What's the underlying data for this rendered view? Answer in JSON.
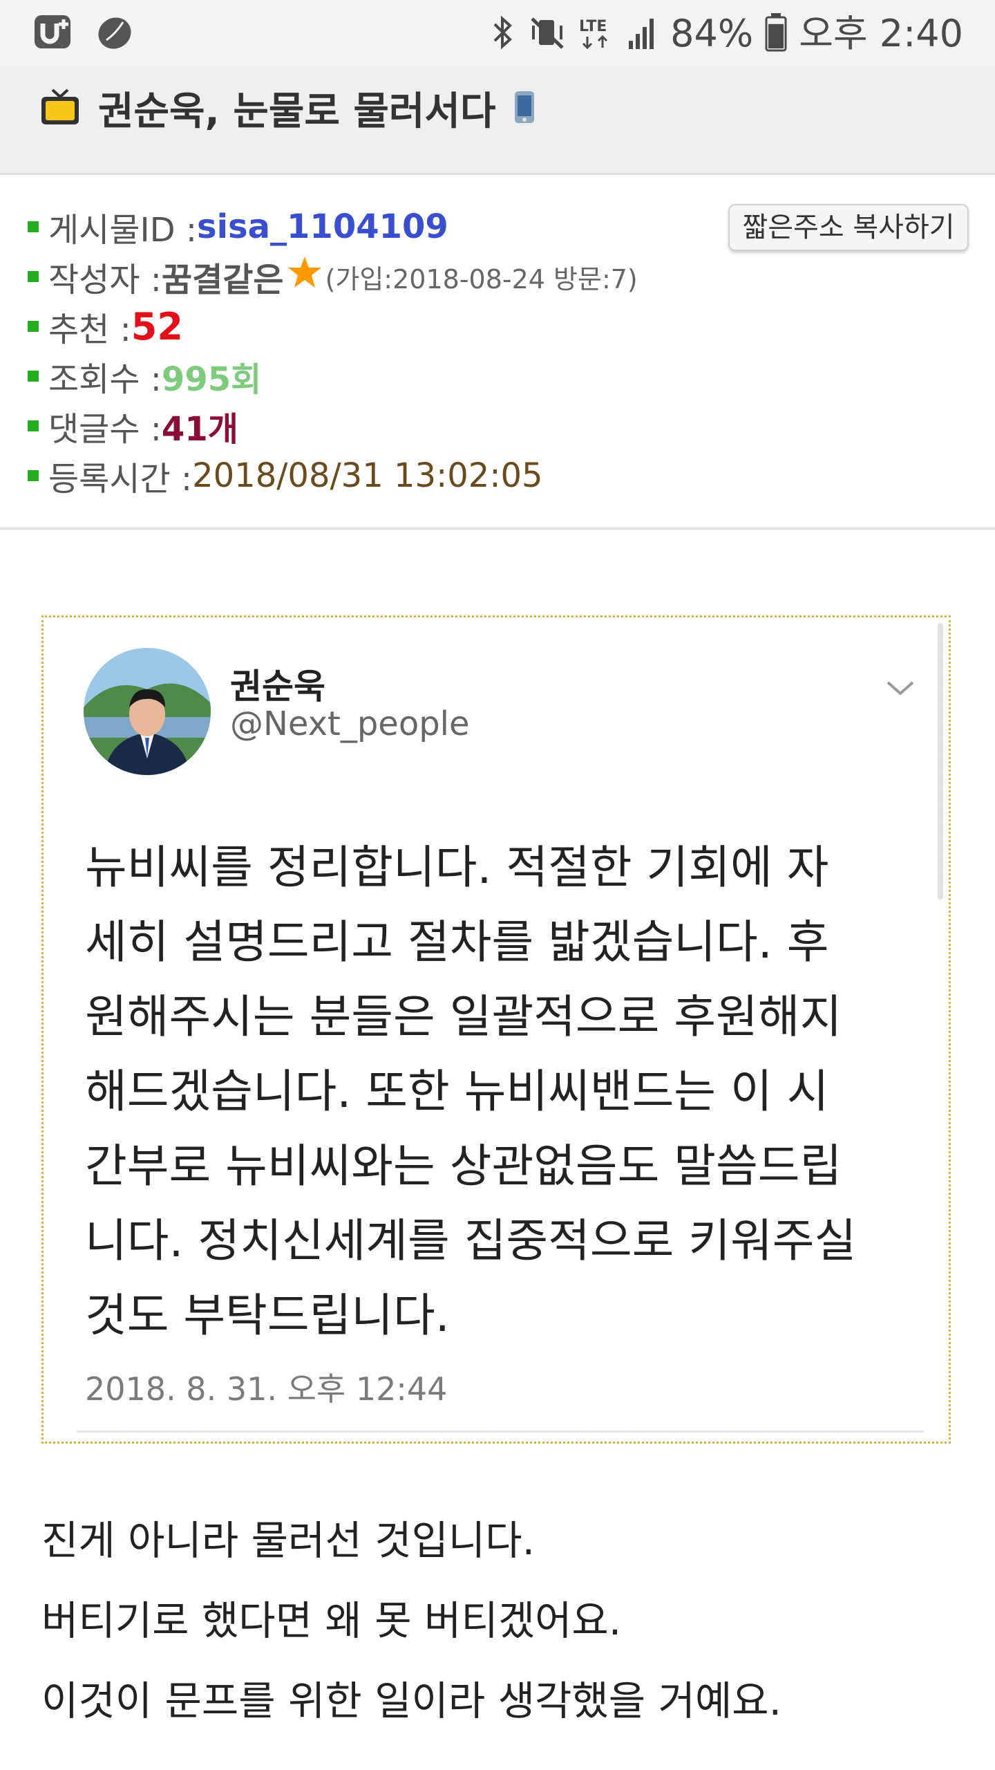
{
  "status_bar": {
    "left_icons": [
      "u-plus-icon",
      "shield-leaf-icon"
    ],
    "right_icons": [
      "bluetooth-icon",
      "vibrate-mute-icon",
      "lte-icon",
      "signal-icon"
    ],
    "battery_percent": "84%",
    "battery_level": 0.84,
    "time": "오후 2:40"
  },
  "post": {
    "title": "권순욱, 눈물로 물러서다",
    "title_icon": "tv-icon",
    "device_icon": "mobile-icon"
  },
  "meta": {
    "copy_button_label": "짧은주소 복사하기",
    "rows": {
      "post_id": {
        "label": "게시물ID : ",
        "value": "sisa_1104109",
        "color": "#3a4fd0"
      },
      "author": {
        "label": "작성자 : ",
        "value": "꿈결같은",
        "extra": "(가입:2018-08-24 방문:7)",
        "badge_icon": "star-icon",
        "color": "#555555",
        "badge_color": "#ff9900"
      },
      "recommend": {
        "label": "추천 : ",
        "value": "52",
        "color": "#e3101a"
      },
      "views": {
        "label": "조회수 : ",
        "value": "995회",
        "color": "#7ecb7e"
      },
      "comments": {
        "label": "댓글수 : ",
        "value": "41개",
        "color": "#8b0d3a"
      },
      "registered": {
        "label": "등록시간 : ",
        "value": "2018/08/31 13:02:05",
        "color": "#6b4a1e"
      }
    }
  },
  "tweet": {
    "name": "권순욱",
    "handle": "@Next_people",
    "lines": [
      "뉴비씨를 정리합니다. 적절한 기회에 자",
      "세히 설명드리고 절차를 밟겠습니다. 후",
      "원해주시는 분들은 일괄적으로 후원해지",
      "해드겠습니다. 또한 뉴비씨밴드는 이 시",
      "간부로 뉴비씨와는 상관없음도 말씀드립",
      "니다. 정치신세계를 집중적으로 키워주실",
      "것도 부탁드립니다."
    ],
    "date": "2018. 8. 31. 오후 12:44",
    "menu_icon": "chevron-down-icon",
    "avatar_icon": "avatar"
  },
  "body": {
    "lines": [
      "진게 아니라 물러선 것입니다.",
      "버티기로 했다면 왜 못 버티겠어요.",
      "이것이 문프를 위한 일이라 생각했을 거예요."
    ]
  }
}
